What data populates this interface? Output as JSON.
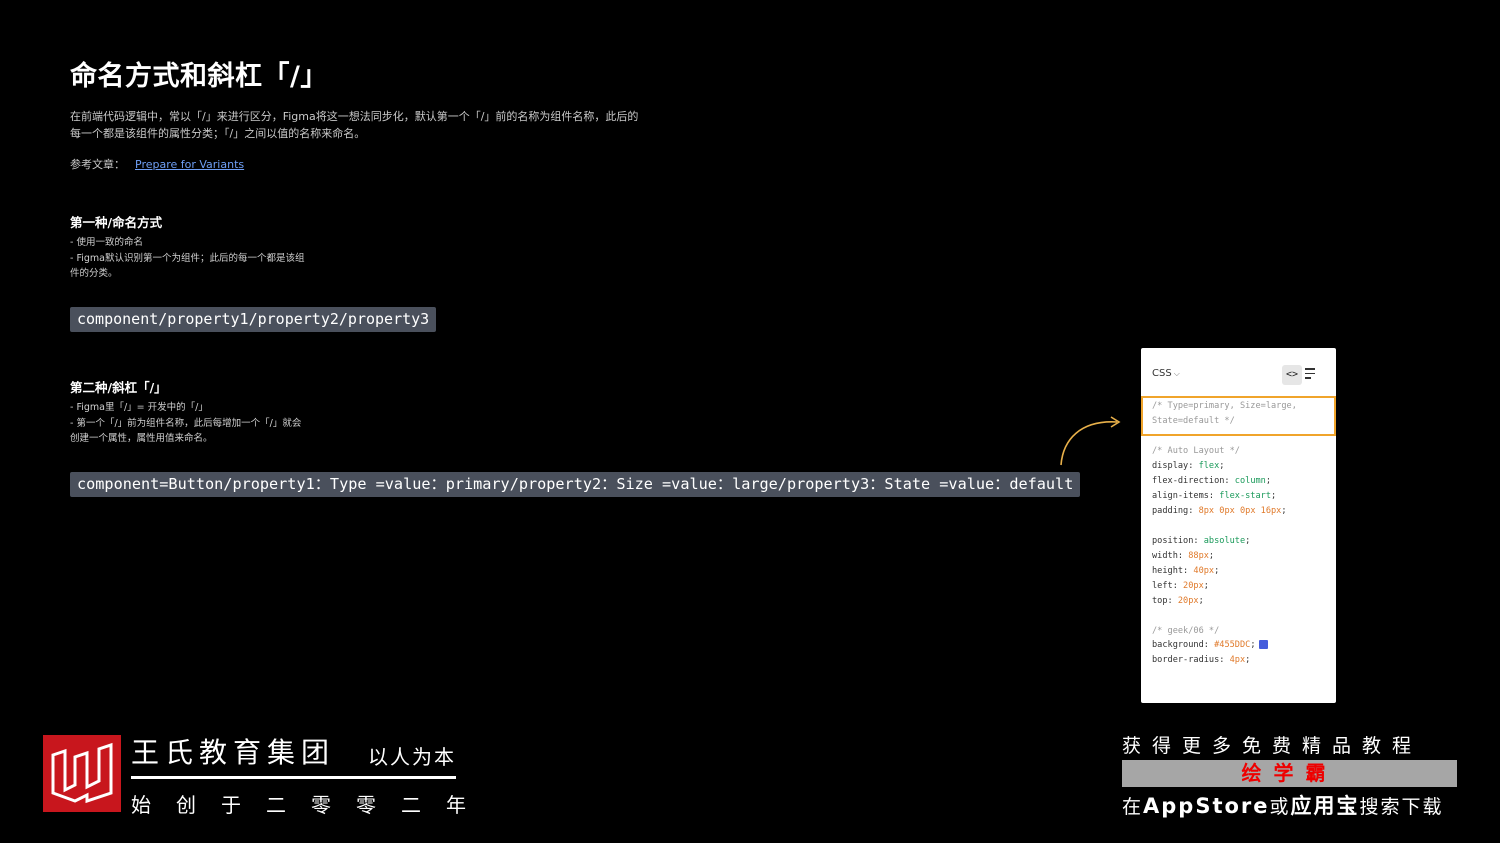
{
  "title": "命名方式和斜杠「/」",
  "description": "在前端代码逻辑中，常以「/」来进行区分，Figma将这一想法同步化，默认第一个「/」前的名称为组件名称，此后的每一个都是该组件的属性分类；「/」之间以值的名称来命名。",
  "reference": {
    "label": "参考文章：",
    "link": "Prepare for Variants"
  },
  "section1": {
    "heading": "第一种/命名方式",
    "line1": "- 使用一致的命名",
    "line2": "- Figma默认识别第一个为组件；此后的每一个都是该组件的分类。",
    "code": "component/property1/property2/property3"
  },
  "section2": {
    "heading": "第二种/斜杠「/」",
    "line1": "- Figma里「/」= 开发中的「/」",
    "line2": "- 第一个「/」前为组件名称，此后每增加一个「/」就会创建一个属性，属性用值来命名。",
    "code": "component=Button/property1：Type =value：primary/property2：Size =value：large/property3：State =value：default"
  },
  "css_panel": {
    "dropdown_label": "CSS",
    "code_icon": "<>",
    "highlight_line1": "/* Type=primary, Size=large,",
    "highlight_line2": "State=default */",
    "lines": [
      {
        "comment": "/* Auto Layout */"
      },
      {
        "prop": "display: ",
        "val": "flex",
        "kind": "kw"
      },
      {
        "prop": "flex-direction: ",
        "val": "column",
        "kind": "kw"
      },
      {
        "prop": "align-items: ",
        "val": "flex-start",
        "kind": "kw"
      },
      {
        "prop": "padding: ",
        "val": "8px 0px 0px 16px",
        "kind": "num"
      },
      {
        "prop": "position: ",
        "val": "absolute",
        "kind": "kw"
      },
      {
        "prop": "width: ",
        "val": "88px",
        "kind": "num"
      },
      {
        "prop": "height: ",
        "val": "40px",
        "kind": "num"
      },
      {
        "prop": "left: ",
        "val": "20px",
        "kind": "num"
      },
      {
        "prop": "top: ",
        "val": "20px",
        "kind": "num"
      },
      {
        "comment": "/* geek/06 */"
      },
      {
        "prop": "background: ",
        "val": "#455DDC",
        "kind": "num",
        "swatch": "#455DDC"
      },
      {
        "prop": "border-radius: ",
        "val": "4px",
        "kind": "num"
      }
    ]
  },
  "footer": {
    "brand": "王氏教育集团",
    "slogan": "以人为本",
    "since": "始创于二零零二年",
    "promo_line1": "获得更多免费精品教程",
    "promo_app": "绘学霸",
    "promo_line3_a": "在",
    "promo_line3_b": "AppStore",
    "promo_line3_c": "或",
    "promo_line3_d": "应用宝",
    "promo_line3_e": "搜索下载",
    "logo_color": "#c8161d"
  }
}
